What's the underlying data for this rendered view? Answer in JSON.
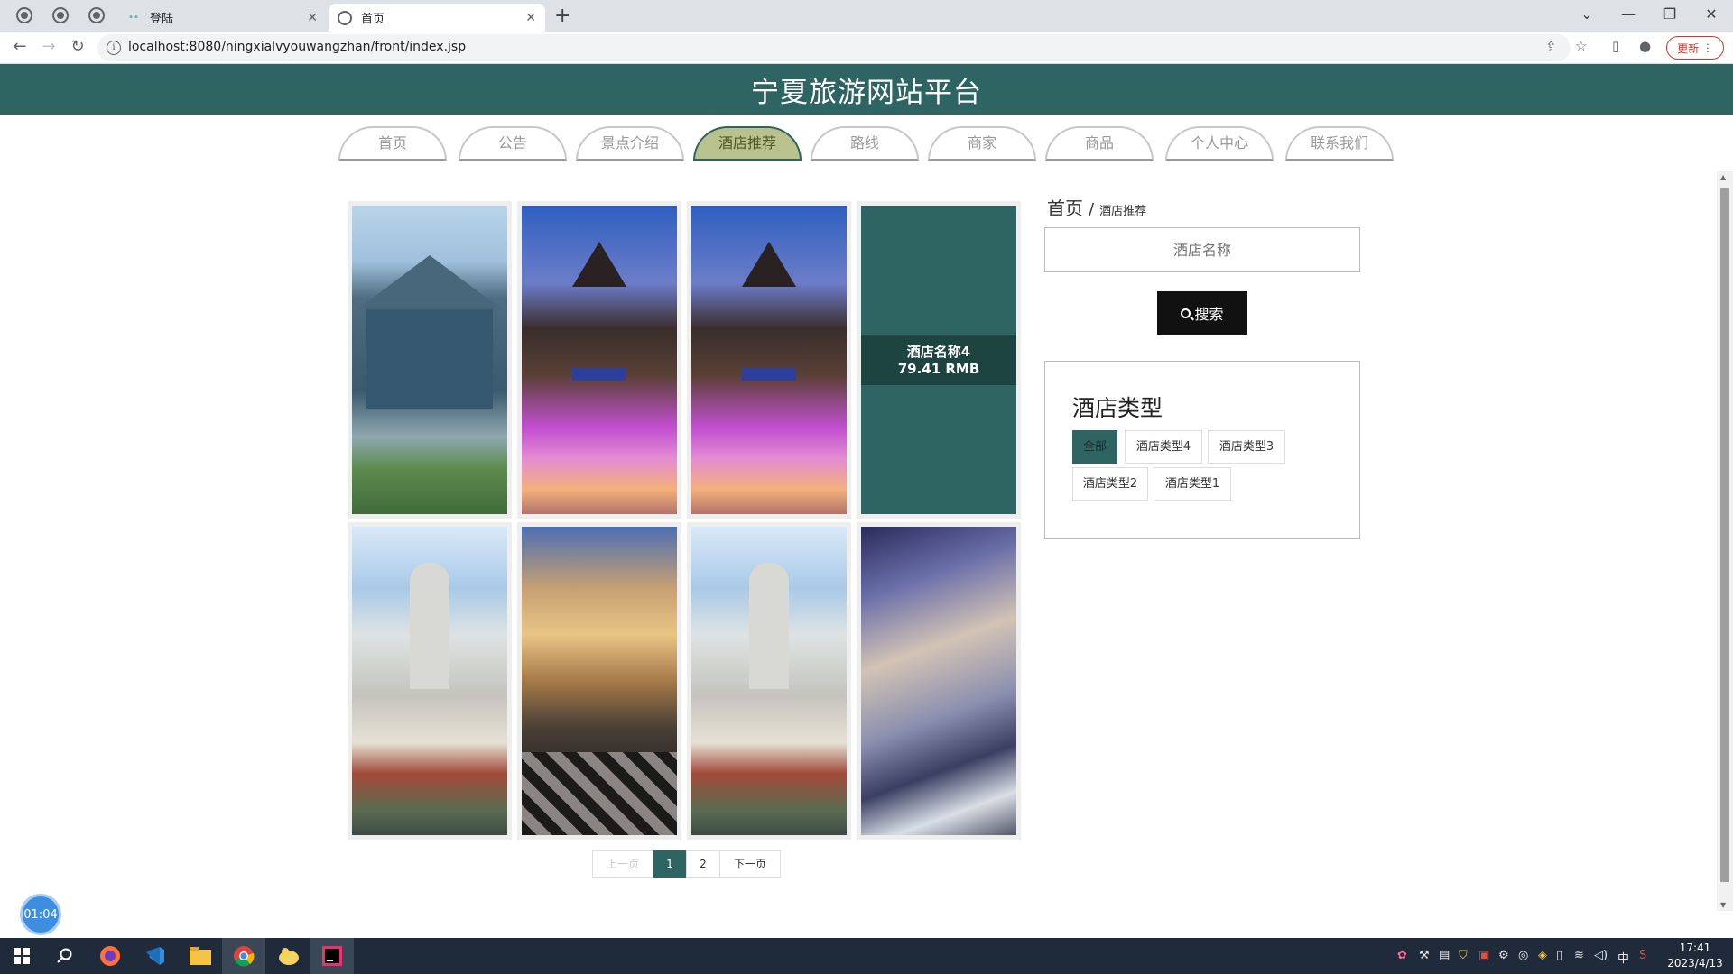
{
  "browser": {
    "tabs": [
      {
        "title": "登陆",
        "active": false
      },
      {
        "title": "首页",
        "active": true
      }
    ],
    "url": "localhost:8080/ningxialvyouwangzhan/front/index.jsp",
    "update_label": "更新"
  },
  "site": {
    "title": "宁夏旅游网站平台",
    "menu": [
      "首页",
      "公告",
      "景点介绍",
      "酒店推荐",
      "路线",
      "商家",
      "商品",
      "个人中心",
      "联系我们"
    ],
    "active_menu": "酒店推荐"
  },
  "hotels": {
    "hover_card": {
      "name": "酒店名称4",
      "price": "79.41 RMB"
    }
  },
  "breadcrumb": {
    "home": "首页",
    "separator": "/",
    "current": "酒店推荐"
  },
  "search": {
    "placeholder": "酒店名称",
    "button_label": "搜索"
  },
  "hotel_types": {
    "title": "酒店类型",
    "tags": [
      "全部",
      "酒店类型4",
      "酒店类型3",
      "酒店类型2",
      "酒店类型1"
    ],
    "selected": "全部"
  },
  "pagination": {
    "prev": "上一页",
    "pages": [
      "1",
      "2"
    ],
    "current": "1",
    "next": "下一页"
  },
  "timer": "01:04",
  "taskbar": {
    "time": "17:41",
    "date": "2023/4/13",
    "ime": "中"
  },
  "colors": {
    "brand": "#2e6563",
    "menu_active": "#b9c28f",
    "update": "#d93025"
  }
}
